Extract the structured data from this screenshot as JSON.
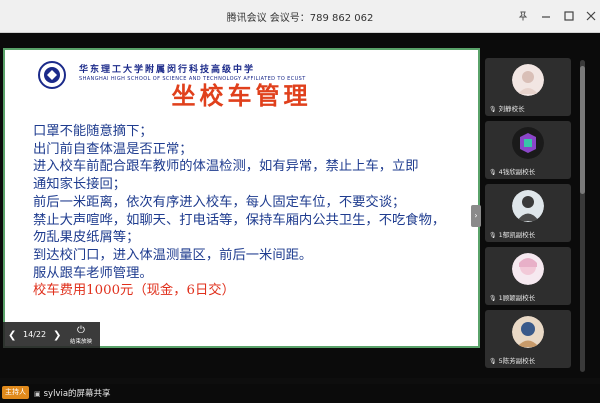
{
  "window": {
    "title": "腾讯会议 会议号：789 862 062",
    "pin_icon": "pin-icon",
    "minimize_icon": "minimize-icon",
    "maximize_icon": "maximize-icon",
    "close_icon": "close-icon"
  },
  "slide": {
    "school_cn": "华东理工大学附属闵行科技高级中学",
    "school_en": "SHANGHAI HIGH SCHOOL OF SCIENCE AND TECHNOLOGY AFFILIATED TO ECUST",
    "title": "坐校车管理",
    "lines": [
      "口罩不能随意摘下；",
      "出门前自查体温是否正常；",
      "进入校车前配合跟车教师的体温检测，如有异常，禁止上车，立即",
      "通知家长接回；",
      "前后一米距离，依次有序进入校车，每人固定车位，不要交谈；",
      "禁止大声喧哗，如聊天、打电话等，保持车厢内公共卫生，不吃食物，",
      "勿乱果皮纸屑等；",
      "到达校门口，进入体温测量区，前后一米间距。",
      "服从跟车老师管理。"
    ],
    "fee_line": "校车费用1000元（现金，6日交）",
    "accent_red": "#e0401c",
    "text_blue": "#1f3c8f"
  },
  "slide_controls": {
    "page": "14/22",
    "stop_label": "结束放映"
  },
  "participants": [
    {
      "name": "刘静校长"
    },
    {
      "name": "4钱欣副校长"
    },
    {
      "name": "1郁凯副校长"
    },
    {
      "name": "1顾颖副校长"
    },
    {
      "name": "5陈芳副校长"
    }
  ],
  "bottom": {
    "host_badge": "主持人",
    "share_text": "sylvia的屏幕共享"
  }
}
